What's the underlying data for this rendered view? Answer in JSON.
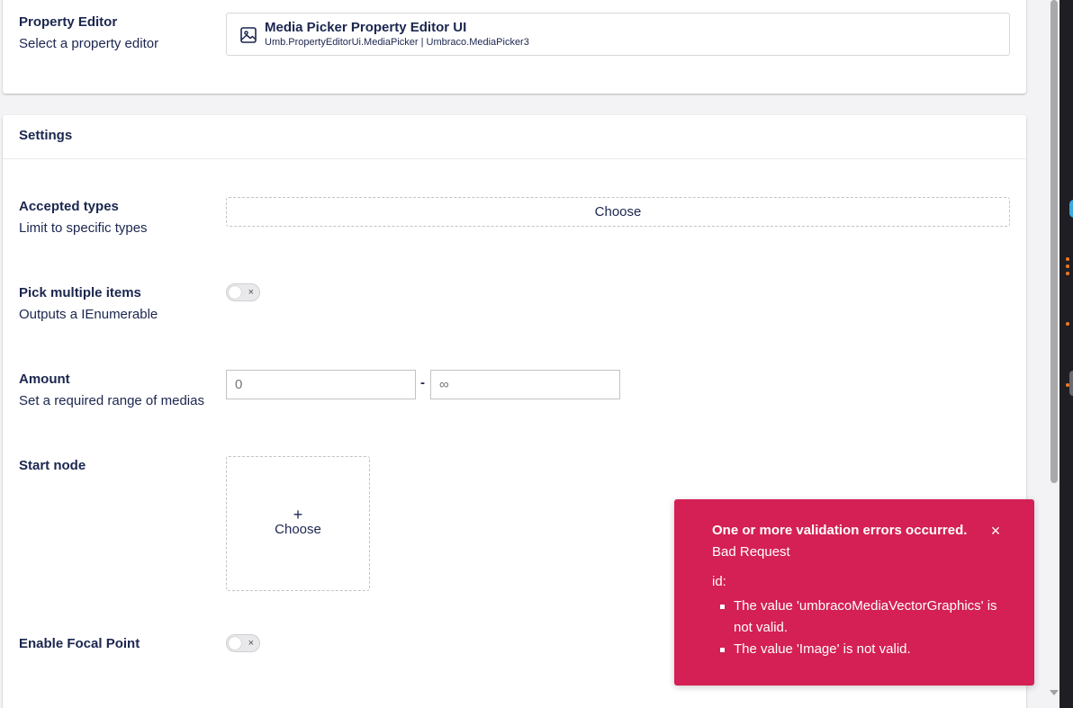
{
  "property_editor": {
    "title": "Property Editor",
    "description": "Select a property editor",
    "selected_name": "Media Picker Property Editor UI",
    "selected_alias": "Umb.PropertyEditorUi.MediaPicker | Umbraco.MediaPicker3",
    "icon": "image-icon"
  },
  "settings": {
    "header": "Settings",
    "accepted_types": {
      "title": "Accepted types",
      "description": "Limit to specific types",
      "button_label": "Choose"
    },
    "pick_multiple": {
      "title": "Pick multiple items",
      "description": "Outputs a IEnumerable",
      "toggle_on": false,
      "toggle_glyph": "×"
    },
    "amount": {
      "title": "Amount",
      "description": "Set a required range of medias",
      "min_placeholder": "0",
      "separator": "-",
      "max_placeholder": "∞"
    },
    "start_node": {
      "title": "Start node",
      "plus": "+",
      "button_label": "Choose"
    },
    "focal_point": {
      "title": "Enable Focal Point",
      "toggle_on": false,
      "toggle_glyph": "×"
    }
  },
  "toast": {
    "headline": "One or more validation errors occurred.",
    "message": "Bad Request",
    "field": "id:",
    "errors": [
      "The value 'umbracoMediaVectorGraphics' is not valid.",
      "The value 'Image' is not valid."
    ],
    "close_glyph": "×",
    "color": "#d42054"
  },
  "colors": {
    "text": "#1b264f",
    "background": "#f3f3f5",
    "card": "#ffffff"
  }
}
